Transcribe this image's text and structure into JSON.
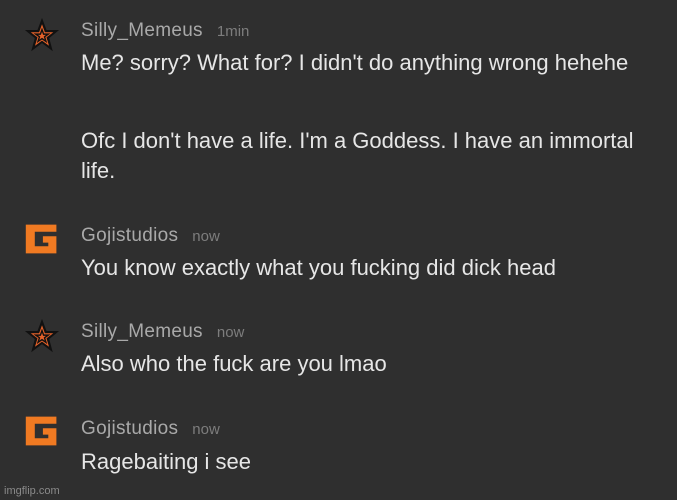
{
  "colors": {
    "background": "#2f2f2f",
    "username": "#a9a9a9",
    "timestamp": "#7d7d7d",
    "message_text": "#e6e6e6",
    "star_fill": "#e8632a",
    "goji_orange": "#f07a22"
  },
  "messages": [
    {
      "user": "Silly_Memeus",
      "time": "1min",
      "avatar_icon": "orange-star-icon",
      "paragraphs": [
        "Me? sorry? What for? I didn't do anything wrong hehehe",
        "Ofc I don't have a life. I'm a Goddess. I have an immortal life."
      ]
    },
    {
      "user": "Gojistudios",
      "time": "now",
      "avatar_icon": "gojistudios-g-logo-icon",
      "paragraphs": [
        "You know exactly what you fucking did dick head"
      ]
    },
    {
      "user": "Silly_Memeus",
      "time": "now",
      "avatar_icon": "orange-star-icon",
      "paragraphs": [
        "Also who the fuck are you lmao"
      ]
    },
    {
      "user": "Gojistudios",
      "time": "now",
      "avatar_icon": "gojistudios-g-logo-icon",
      "paragraphs": [
        "Ragebaiting i see"
      ]
    }
  ],
  "watermark": "imgflip.com"
}
